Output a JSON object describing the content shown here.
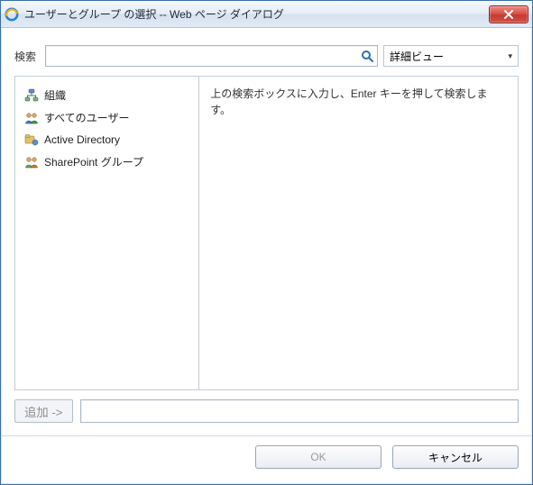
{
  "window": {
    "title": "ユーザーとグループ の選択 -- Web ページ ダイアログ"
  },
  "search": {
    "label": "検索",
    "value": "",
    "placeholder": ""
  },
  "view": {
    "selected": "詳細ビュー"
  },
  "tree": {
    "items": [
      {
        "label": "組織"
      },
      {
        "label": "すべてのユーザー"
      },
      {
        "label": "Active Directory"
      },
      {
        "label": "SharePoint グループ"
      }
    ]
  },
  "results": {
    "hint": "上の検索ボックスに入力し、Enter キーを押して検索します。"
  },
  "addRow": {
    "button": "追加 ->",
    "value": ""
  },
  "footer": {
    "ok": "OK",
    "cancel": "キャンセル"
  }
}
